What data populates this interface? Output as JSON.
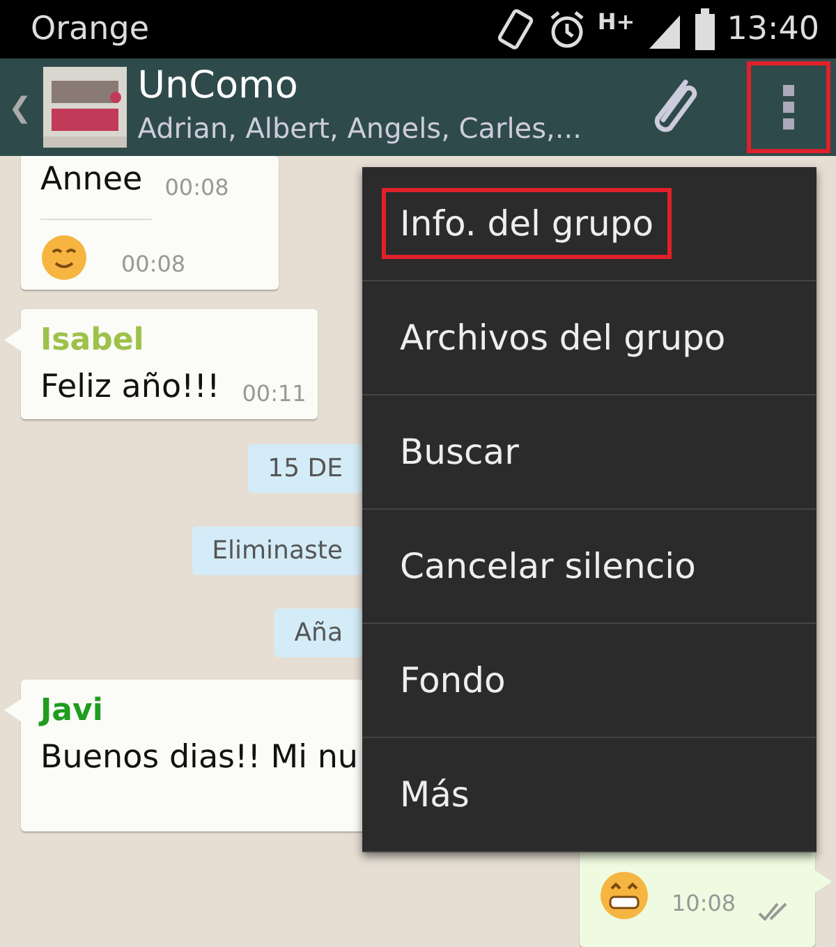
{
  "status_bar": {
    "carrier": "Orange",
    "network": "H+",
    "time": "13:40"
  },
  "header": {
    "back": "❮",
    "title": "UnComo",
    "subtitle": "Adrian, Albert, Angels, Carles,...",
    "overflow_highlighted": true
  },
  "messages": [
    {
      "kind": "incoming",
      "text": "Annee",
      "time": "00:08",
      "emoji_time": "00:08"
    },
    {
      "kind": "incoming",
      "sender": "Isabel",
      "color": "#9ec14a",
      "text": "Feliz año!!!",
      "time": "00:11"
    },
    {
      "kind": "notice",
      "text": "15 DE"
    },
    {
      "kind": "notice",
      "text": "Eliminaste"
    },
    {
      "kind": "notice",
      "text": "Aña"
    },
    {
      "kind": "incoming",
      "sender": "Javi",
      "color": "#1f9d1f",
      "text": "Buenos dias!! Mi nu"
    },
    {
      "kind": "outgoing",
      "time": "10:08"
    }
  ],
  "menu": [
    {
      "label": "Info. del grupo",
      "highlighted": true
    },
    {
      "label": "Archivos del grupo",
      "highlighted": false
    },
    {
      "label": "Buscar",
      "highlighted": false
    },
    {
      "label": "Cancelar silencio",
      "highlighted": false
    },
    {
      "label": "Fondo",
      "highlighted": false
    },
    {
      "label": "Más",
      "highlighted": false
    }
  ]
}
